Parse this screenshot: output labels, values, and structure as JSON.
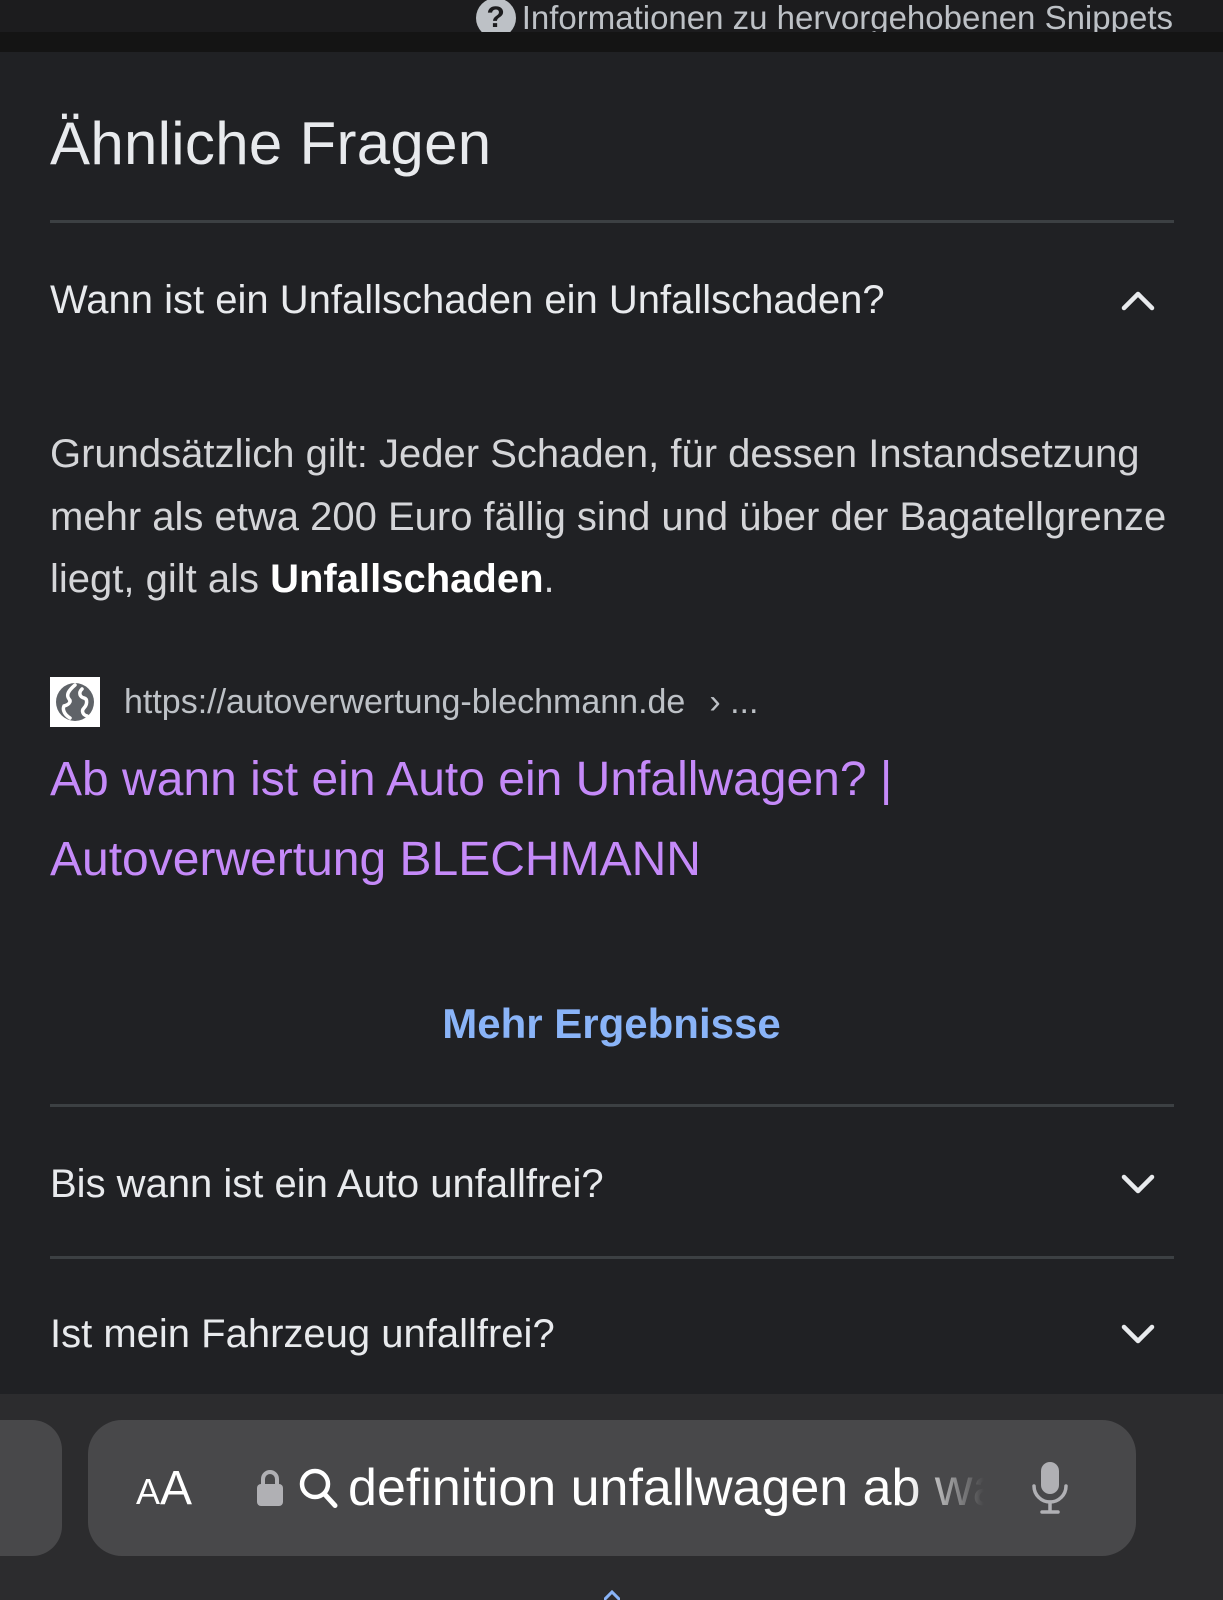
{
  "top_info": {
    "label": "Informationen zu hervorgehobenen Snippets"
  },
  "related_questions": {
    "heading": "Ähnliche Fragen",
    "items": [
      {
        "question": "Wann ist ein Unfallschaden ein Unfallschaden?",
        "expanded": true,
        "answer_text": "Grundsätzlich gilt: Jeder Schaden, für dessen Instandsetzung mehr als etwa 200 Euro fällig sind und über der Bagatellgrenze liegt, gilt als ",
        "answer_bold": "Unfallschaden",
        "answer_end": ".",
        "source_url": "https://autoverwertung-blechmann.de",
        "source_sep": "› ...",
        "result_title": "Ab wann ist ein Auto ein Unfallwagen? | Autoverwertung BLECHMANN"
      },
      {
        "question": "Bis wann ist ein Auto unfallfrei?",
        "expanded": false
      },
      {
        "question": "Ist mein Fahrzeug unfallfrei?",
        "expanded": false
      }
    ],
    "more_results": "Mehr Ergebnisse"
  },
  "browser_bar": {
    "aa_small": "A",
    "aa_large": "A",
    "url_text": "definition unfallwagen ab wann"
  },
  "colors": {
    "background": "#202124",
    "link_visited": "#c58af9",
    "link_blue": "#8ab4f8",
    "text_primary": "#e8eaed",
    "bar_background": "#2c2c2e"
  }
}
